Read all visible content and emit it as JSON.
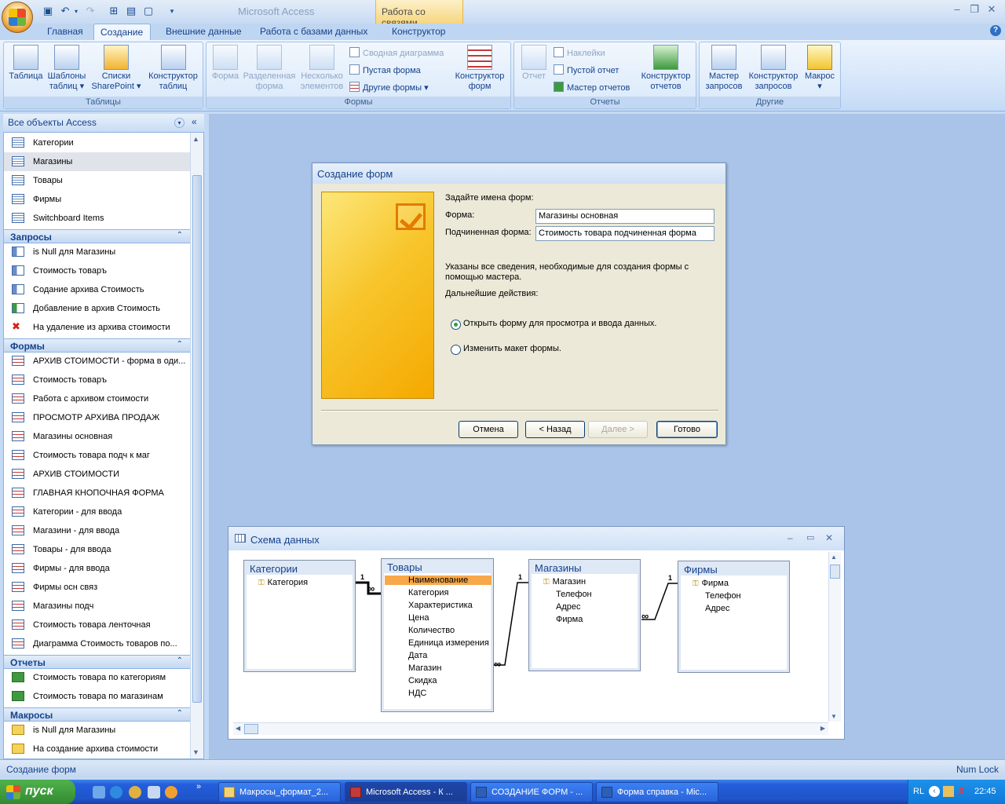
{
  "app": {
    "title": "Microsoft Access",
    "context_tab": "Работа со связями"
  },
  "tabs": [
    "Главная",
    "Создание",
    "Внешние данные",
    "Работа с базами данных",
    "Конструктор"
  ],
  "ribbon": {
    "tables": {
      "title": "Таблицы",
      "table": "Таблица",
      "templates1": "Шаблоны",
      "templates2": "таблиц",
      "lists1": "Списки",
      "lists2": "SharePoint",
      "designer1": "Конструктор",
      "designer2": "таблиц"
    },
    "forms": {
      "title": "Формы",
      "form": "Форма",
      "split1": "Разделенная",
      "split2": "форма",
      "multi1": "Несколько",
      "multi2": "элементов",
      "pivot": "Сводная диаграмма",
      "blank": "Пустая форма",
      "other": "Другие формы",
      "designer1": "Конструктор",
      "designer2": "форм"
    },
    "reports": {
      "title": "Отчеты",
      "report": "Отчет",
      "labels": "Наклейки",
      "blank": "Пустой отчет",
      "wizard": "Мастер отчетов",
      "designer1": "Конструктор",
      "designer2": "отчетов"
    },
    "other": {
      "title": "Другие",
      "qwizard1": "Мастер",
      "qwizard2": "запросов",
      "qdesigner1": "Конструктор",
      "qdesigner2": "запросов",
      "macro": "Макрос"
    }
  },
  "nav": {
    "title": "Все объекты Access",
    "tables": [
      "Категории",
      "Магазины",
      "Товары",
      "Фирмы",
      "Switchboard Items"
    ],
    "queries_title": "Запросы",
    "queries": [
      "is Null для Магазины",
      "Стоимость товаръ",
      "Содание архива Стоимость",
      "Добавление в архив Стоимость",
      "На удаление из архива стоимости"
    ],
    "forms_title": "Формы",
    "forms": [
      "АРХИВ СТОИМОСТИ - форма в оди...",
      "Стоимость товаръ",
      "Работа с архивом стоимости",
      "ПРОСМОТР АРХИВА ПРОДАЖ",
      "Магазины основная",
      "Стоимость товара подч к маг",
      "АРХИВ СТОИМОСТИ",
      "ГЛАВНАЯ КНОПОЧНАЯ ФОРМА",
      "Категории - для ввода",
      "Магазини - для ввода",
      "Товары - для ввода",
      "Фирмы - для ввода",
      "Фирмы осн связ",
      "Магазины подч",
      "Стоимость товара ленточная",
      "Диаграмма Стоимость товаров по..."
    ],
    "reports_title": "Отчеты",
    "reports": [
      "Стоимость товара по категориям",
      "Стоимость товара по магазинам"
    ],
    "macros_title": "Макросы",
    "macros": [
      "is Null для Магазины",
      "На создание архива стоимости"
    ]
  },
  "dialog": {
    "title": "Создание форм",
    "prompt": "Задайте имена форм:",
    "form_label": "Форма:",
    "form_value": "Магазины основная",
    "subform_label": "Подчиненная форма:",
    "subform_value": "Стоимость товара подчиненная форма",
    "info1": "Указаны все сведения, необходимые для создания формы с",
    "info2": "помощью мастера.",
    "next_actions": "Дальнейшие действия:",
    "option1": "Открыть форму для просмотра и ввода данных.",
    "option2": "Изменить макет формы.",
    "cancel": "Отмена",
    "back": "< Назад",
    "next": "Далее >",
    "finish": "Готово"
  },
  "schema": {
    "title": "Схема данных",
    "tables": [
      {
        "name": "Категории",
        "fields": [
          "Категория"
        ]
      },
      {
        "name": "Товары",
        "fields": [
          "Наименование",
          "Категория",
          "Характеристика",
          "Цена",
          "Количество",
          "Единица измерения",
          "Дата",
          "Магазин",
          "Скидка",
          "НДС"
        ]
      },
      {
        "name": "Магазины",
        "fields": [
          "Магазин",
          "Телефон",
          "Адрес",
          "Фирма"
        ]
      },
      {
        "name": "Фирмы",
        "fields": [
          "Фирма",
          "Телефон",
          "Адрес"
        ]
      }
    ],
    "rel_one": "1",
    "rel_many": "∞"
  },
  "status": {
    "left": "Создание форм",
    "right": "Num Lock"
  },
  "taskbar": {
    "start": "пуск",
    "tasks": [
      "Макросы_формат_2...",
      "Microsoft Access - К ...",
      "СОЗДАНИЕ ФОРМ - ...",
      "Форма справка - Mic..."
    ],
    "lang": "RL",
    "time": "22:45"
  }
}
